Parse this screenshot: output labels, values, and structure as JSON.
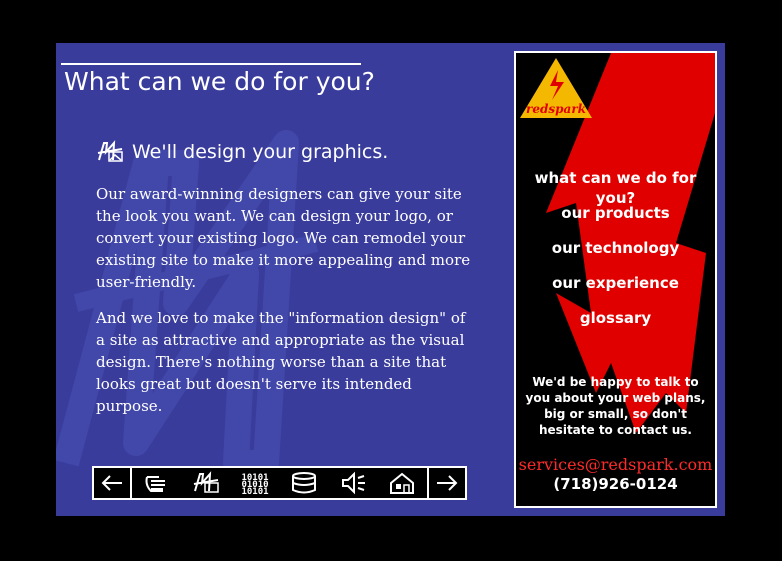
{
  "page": {
    "title": "What can we do for you?",
    "section_title": "We'll design your graphics.",
    "section_icon": "graphics-icon",
    "paragraph1": "Our award-winning designers can give your site the look you want. We can design your logo, or convert your existing logo. We can remodel your existing site to make it more appealing and more user-friendly.",
    "paragraph2": "And we love to make the \"information design\" of a site as attractive and appropriate as the visual design. There's nothing worse than a site that looks great but doesn't serve its intended purpose."
  },
  "navbar": {
    "icons": [
      "arrow-left-icon",
      "hand-icon",
      "graphics-icon",
      "binary-code-icon",
      "database-icon",
      "speaker-icon",
      "house-icon",
      "arrow-right-icon"
    ]
  },
  "sidebar": {
    "logo_text": "redspark",
    "menu": [
      {
        "label": "what can we do for you?"
      },
      {
        "label": "our products"
      },
      {
        "label": "our technology"
      },
      {
        "label": "our experience"
      },
      {
        "label": "glossary"
      }
    ],
    "contact_message": "We'd be happy to talk to you about your web plans, big or small, so don't hesitate to contact us.",
    "email": "services@redspark.com",
    "phone": "(718)926-0124"
  },
  "colors": {
    "panel_bg": "#3a3c9c",
    "accent_red": "#e00000",
    "logo_yellow": "#f5b800",
    "email_color": "#ff2a2a"
  }
}
